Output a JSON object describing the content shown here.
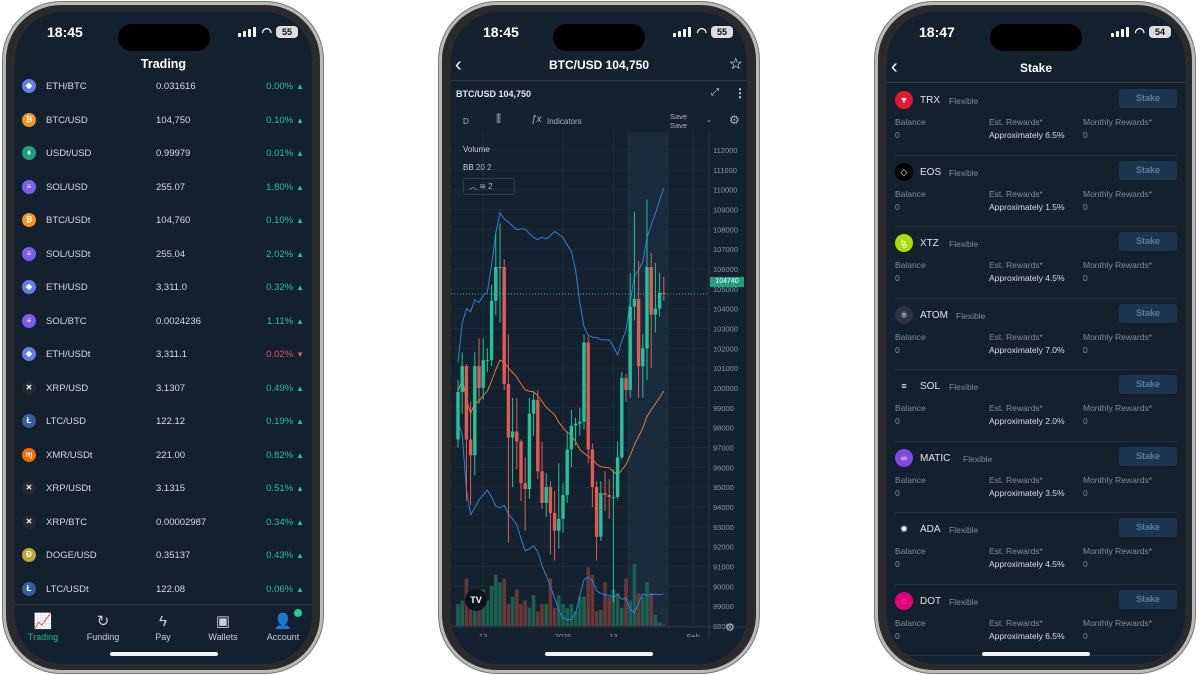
{
  "colors": {
    "bg": "#13202e",
    "up": "#22c39b",
    "down": "#e25a55",
    "accent": "#1fb98f",
    "bb_band": "#2f7fd6",
    "bb_mid": "#e07b2f"
  },
  "trading_phone": {
    "status": {
      "time": "18:45",
      "battery": "55"
    },
    "title": "Trading",
    "rows": [
      {
        "icon": "eth-icon",
        "glyph": "◆",
        "color": "#627eea",
        "pair": "ETH/BTC",
        "price": "0.031616",
        "change": "0.00%",
        "dir": "up"
      },
      {
        "icon": "btc-icon",
        "glyph": "₿",
        "color": "#f7931a",
        "pair": "BTC/USD",
        "price": "104,750",
        "change": "0.10%",
        "dir": "up"
      },
      {
        "icon": "usdt-icon",
        "glyph": "♦",
        "color": "#1ba27a",
        "pair": "USDt/USD",
        "price": "0.99979",
        "change": "0.01%",
        "dir": "up"
      },
      {
        "icon": "sol-icon",
        "glyph": "≡",
        "color": "#7b5cf0",
        "pair": "SOL/USD",
        "price": "255.07",
        "change": "1.80%",
        "dir": "up"
      },
      {
        "icon": "btc-icon",
        "glyph": "₿",
        "color": "#f7931a",
        "pair": "BTC/USDt",
        "price": "104,760",
        "change": "0.10%",
        "dir": "up"
      },
      {
        "icon": "sol-icon",
        "glyph": "≡",
        "color": "#7b5cf0",
        "pair": "SOL/USDt",
        "price": "255.04",
        "change": "2.02%",
        "dir": "up"
      },
      {
        "icon": "eth-icon",
        "glyph": "◆",
        "color": "#627eea",
        "pair": "ETH/USD",
        "price": "3,311.0",
        "change": "0.32%",
        "dir": "up"
      },
      {
        "icon": "sol-icon",
        "glyph": "≡",
        "color": "#7b5cf0",
        "pair": "SOL/BTC",
        "price": "0.0024236",
        "change": "1.11%",
        "dir": "up"
      },
      {
        "icon": "eth-icon",
        "glyph": "◆",
        "color": "#627eea",
        "pair": "ETH/USDt",
        "price": "3,311.1",
        "change": "0.02%",
        "dir": "down"
      },
      {
        "icon": "xrp-icon",
        "glyph": "✕",
        "color": "#23292f",
        "pair": "XRP/USD",
        "price": "3.1307",
        "change": "0.49%",
        "dir": "up"
      },
      {
        "icon": "ltc-icon",
        "glyph": "Ł",
        "color": "#345d9d",
        "pair": "LTC/USD",
        "price": "122.12",
        "change": "0.19%",
        "dir": "up"
      },
      {
        "icon": "xmr-icon",
        "glyph": "ɱ",
        "color": "#ff6600",
        "pair": "XMR/USDt",
        "price": "221.00",
        "change": "0.82%",
        "dir": "up"
      },
      {
        "icon": "xrp-icon",
        "glyph": "✕",
        "color": "#23292f",
        "pair": "XRP/USDt",
        "price": "3.1315",
        "change": "0.51%",
        "dir": "up"
      },
      {
        "icon": "xrp-icon",
        "glyph": "✕",
        "color": "#23292f",
        "pair": "XRP/BTC",
        "price": "0.00002987",
        "change": "0.34%",
        "dir": "up"
      },
      {
        "icon": "doge-icon",
        "glyph": "Ð",
        "color": "#c2a633",
        "pair": "DOGE/USD",
        "price": "0.35137",
        "change": "0.43%",
        "dir": "up"
      },
      {
        "icon": "ltc-icon",
        "glyph": "Ł",
        "color": "#345d9d",
        "pair": "LTC/USDt",
        "price": "122.08",
        "change": "0.06%",
        "dir": "up"
      }
    ],
    "tabs": [
      {
        "label": "Trading",
        "icon": "chart-icon",
        "glyph": "📈",
        "active": true
      },
      {
        "label": "Funding",
        "icon": "refresh-icon",
        "glyph": "↻"
      },
      {
        "label": "Pay",
        "icon": "lightning-icon",
        "glyph": "ϟ"
      },
      {
        "label": "Wallets",
        "icon": "wallet-icon",
        "glyph": "▣"
      },
      {
        "label": "Account",
        "icon": "user-icon",
        "glyph": "👤"
      }
    ]
  },
  "chart_phone": {
    "status": {
      "time": "18:45",
      "battery": "55"
    },
    "nav_title": "BTC/USD 104,750",
    "chart_title": "BTC/USD 104,750",
    "toolbar": {
      "interval": "D",
      "indicators": "Indicators",
      "save1": "Save",
      "save2": "Save"
    },
    "legend": {
      "volume": "Volume",
      "bb": "BB",
      "bb_params": "20 2",
      "layers_count": "2"
    },
    "last_price_label": "104740",
    "chart_data": {
      "type": "candlestick",
      "ylim": [
        88000,
        112000
      ],
      "y_ticks": [
        "112000",
        "111000",
        "110000",
        "109000",
        "108000",
        "107000",
        "106000",
        "105000",
        "104000",
        "103000",
        "102000",
        "101000",
        "100000",
        "99000",
        "98000",
        "97000",
        "96000",
        "95000",
        "94000",
        "93000",
        "92000",
        "91000",
        "90000",
        "89000",
        "88000"
      ],
      "x_ticks": [
        {
          "label": "13",
          "index": 6
        },
        {
          "label": "2025",
          "index": 25
        },
        {
          "label": "13",
          "index": 37
        },
        {
          "label": "Feb",
          "index": 56
        }
      ],
      "closes": [
        99800,
        101100,
        97400,
        96600,
        101100,
        100000,
        101400,
        101400,
        104400,
        106100,
        106100,
        100200,
        97500,
        97800,
        97300,
        95200,
        94900,
        98700,
        99400,
        95800,
        94200,
        95000,
        93700,
        92800,
        93400,
        94600,
        96900,
        98100,
        98200,
        98300,
        102300,
        96900,
        95000,
        92500,
        94700,
        94600,
        94500,
        94500,
        96500,
        100500,
        99900,
        104100,
        104500,
        101100,
        102000,
        106100,
        103700,
        104000,
        104800,
        104750
      ],
      "opens": [
        97400,
        99800,
        101100,
        97400,
        96600,
        101100,
        100000,
        101400,
        101400,
        104400,
        106100,
        106100,
        100200,
        97500,
        97800,
        97300,
        95200,
        94900,
        98700,
        99400,
        95800,
        94200,
        95000,
        93700,
        92800,
        93400,
        94600,
        96900,
        98100,
        98200,
        98300,
        102300,
        96900,
        95000,
        92500,
        94700,
        94600,
        94500,
        94500,
        96500,
        100500,
        99900,
        104100,
        104500,
        101100,
        102000,
        106100,
        103700,
        104000,
        104800
      ],
      "highs": [
        100400,
        101800,
        101200,
        99300,
        101800,
        102500,
        102500,
        102000,
        105200,
        107800,
        108300,
        106500,
        102700,
        99500,
        99500,
        97400,
        96500,
        99500,
        99800,
        99900,
        97300,
        95700,
        95300,
        94800,
        96200,
        95200,
        97800,
        98900,
        98500,
        99000,
        102700,
        102600,
        97200,
        95300,
        95300,
        95800,
        95400,
        95900,
        97300,
        100800,
        100700,
        105800,
        108900,
        106400,
        102700,
        109500,
        106800,
        106300,
        105800,
        105600
      ],
      "lows": [
        97000,
        98700,
        94300,
        94100,
        95600,
        99200,
        99400,
        100800,
        101100,
        103700,
        103300,
        99900,
        92200,
        95000,
        95900,
        94300,
        92800,
        94400,
        97600,
        95400,
        93900,
        93500,
        91600,
        91300,
        91900,
        92700,
        94200,
        96000,
        97100,
        97600,
        97900,
        96200,
        94000,
        91300,
        92300,
        93800,
        93400,
        89200,
        94400,
        96400,
        99300,
        99500,
        103400,
        99500,
        99500,
        100400,
        101000,
        102800,
        103600,
        104400
      ],
      "volume": [
        3,
        3.5,
        6.5,
        4,
        4.5,
        4.8,
        5,
        3.5,
        5.5,
        7,
        6,
        6.5,
        3,
        4,
        5,
        3,
        3.5,
        2.5,
        4.2,
        2,
        3,
        3,
        6.5,
        2.5,
        4.2,
        3,
        2.5,
        3,
        2,
        4,
        4,
        8,
        7,
        2,
        2.2,
        6,
        4,
        5,
        4.5,
        2.5,
        6.5,
        3.5,
        8.5,
        4.5,
        4,
        6,
        4.5,
        1.5,
        0.5,
        0.2
      ],
      "indicators": [
        "Volume",
        "BB 20 2"
      ]
    }
  },
  "stake_phone": {
    "status": {
      "time": "18:47",
      "battery": "54"
    },
    "title": "Stake",
    "labels": {
      "balance": "Balance",
      "est": "Est. Rewards*",
      "monthly": "Monthly Rewards*",
      "button": "Stake"
    },
    "assets": [
      {
        "name": "TRX",
        "type": "Flexible",
        "balance": "0",
        "est": "Approximately 6.5%",
        "monthly": "0",
        "icon": "trx-icon",
        "color": "#e5162f",
        "glyph": "▼"
      },
      {
        "name": "EOS",
        "type": "Flexible",
        "balance": "0",
        "est": "Approximately 1.5%",
        "monthly": "0",
        "icon": "eos-icon",
        "color": "#000000",
        "glyph": "◇"
      },
      {
        "name": "XTZ",
        "type": "Flexible",
        "balance": "0",
        "est": "Approximately 4.5%",
        "monthly": "0",
        "icon": "xtz-icon",
        "color": "#a6e000",
        "glyph": "ꜩ"
      },
      {
        "name": "ATOM",
        "type": "Flexible",
        "balance": "0",
        "est": "Approximately 7.0%",
        "monthly": "0",
        "icon": "atom-icon",
        "color": "#2e3148",
        "glyph": "⚛"
      },
      {
        "name": "SOL",
        "type": "Flexible",
        "balance": "0",
        "est": "Approximately 2.0%",
        "monthly": "0",
        "icon": "sol-icon",
        "color": "#13202e",
        "glyph": "≡"
      },
      {
        "name": "MATIC",
        "type": "Flexible",
        "balance": "0",
        "est": "Approximately 3.5%",
        "monthly": "0",
        "icon": "matic-icon",
        "color": "#8247e5",
        "glyph": "∞"
      },
      {
        "name": "ADA",
        "type": "Flexible",
        "balance": "0",
        "est": "Approximately 4.5%",
        "monthly": "0",
        "icon": "ada-icon",
        "color": "#13202e",
        "glyph": "✺"
      },
      {
        "name": "DOT",
        "type": "Flexible",
        "balance": "0",
        "est": "Approximately 6.5%",
        "monthly": "0",
        "icon": "dot-icon",
        "color": "#e6007a",
        "glyph": "◌"
      }
    ]
  }
}
